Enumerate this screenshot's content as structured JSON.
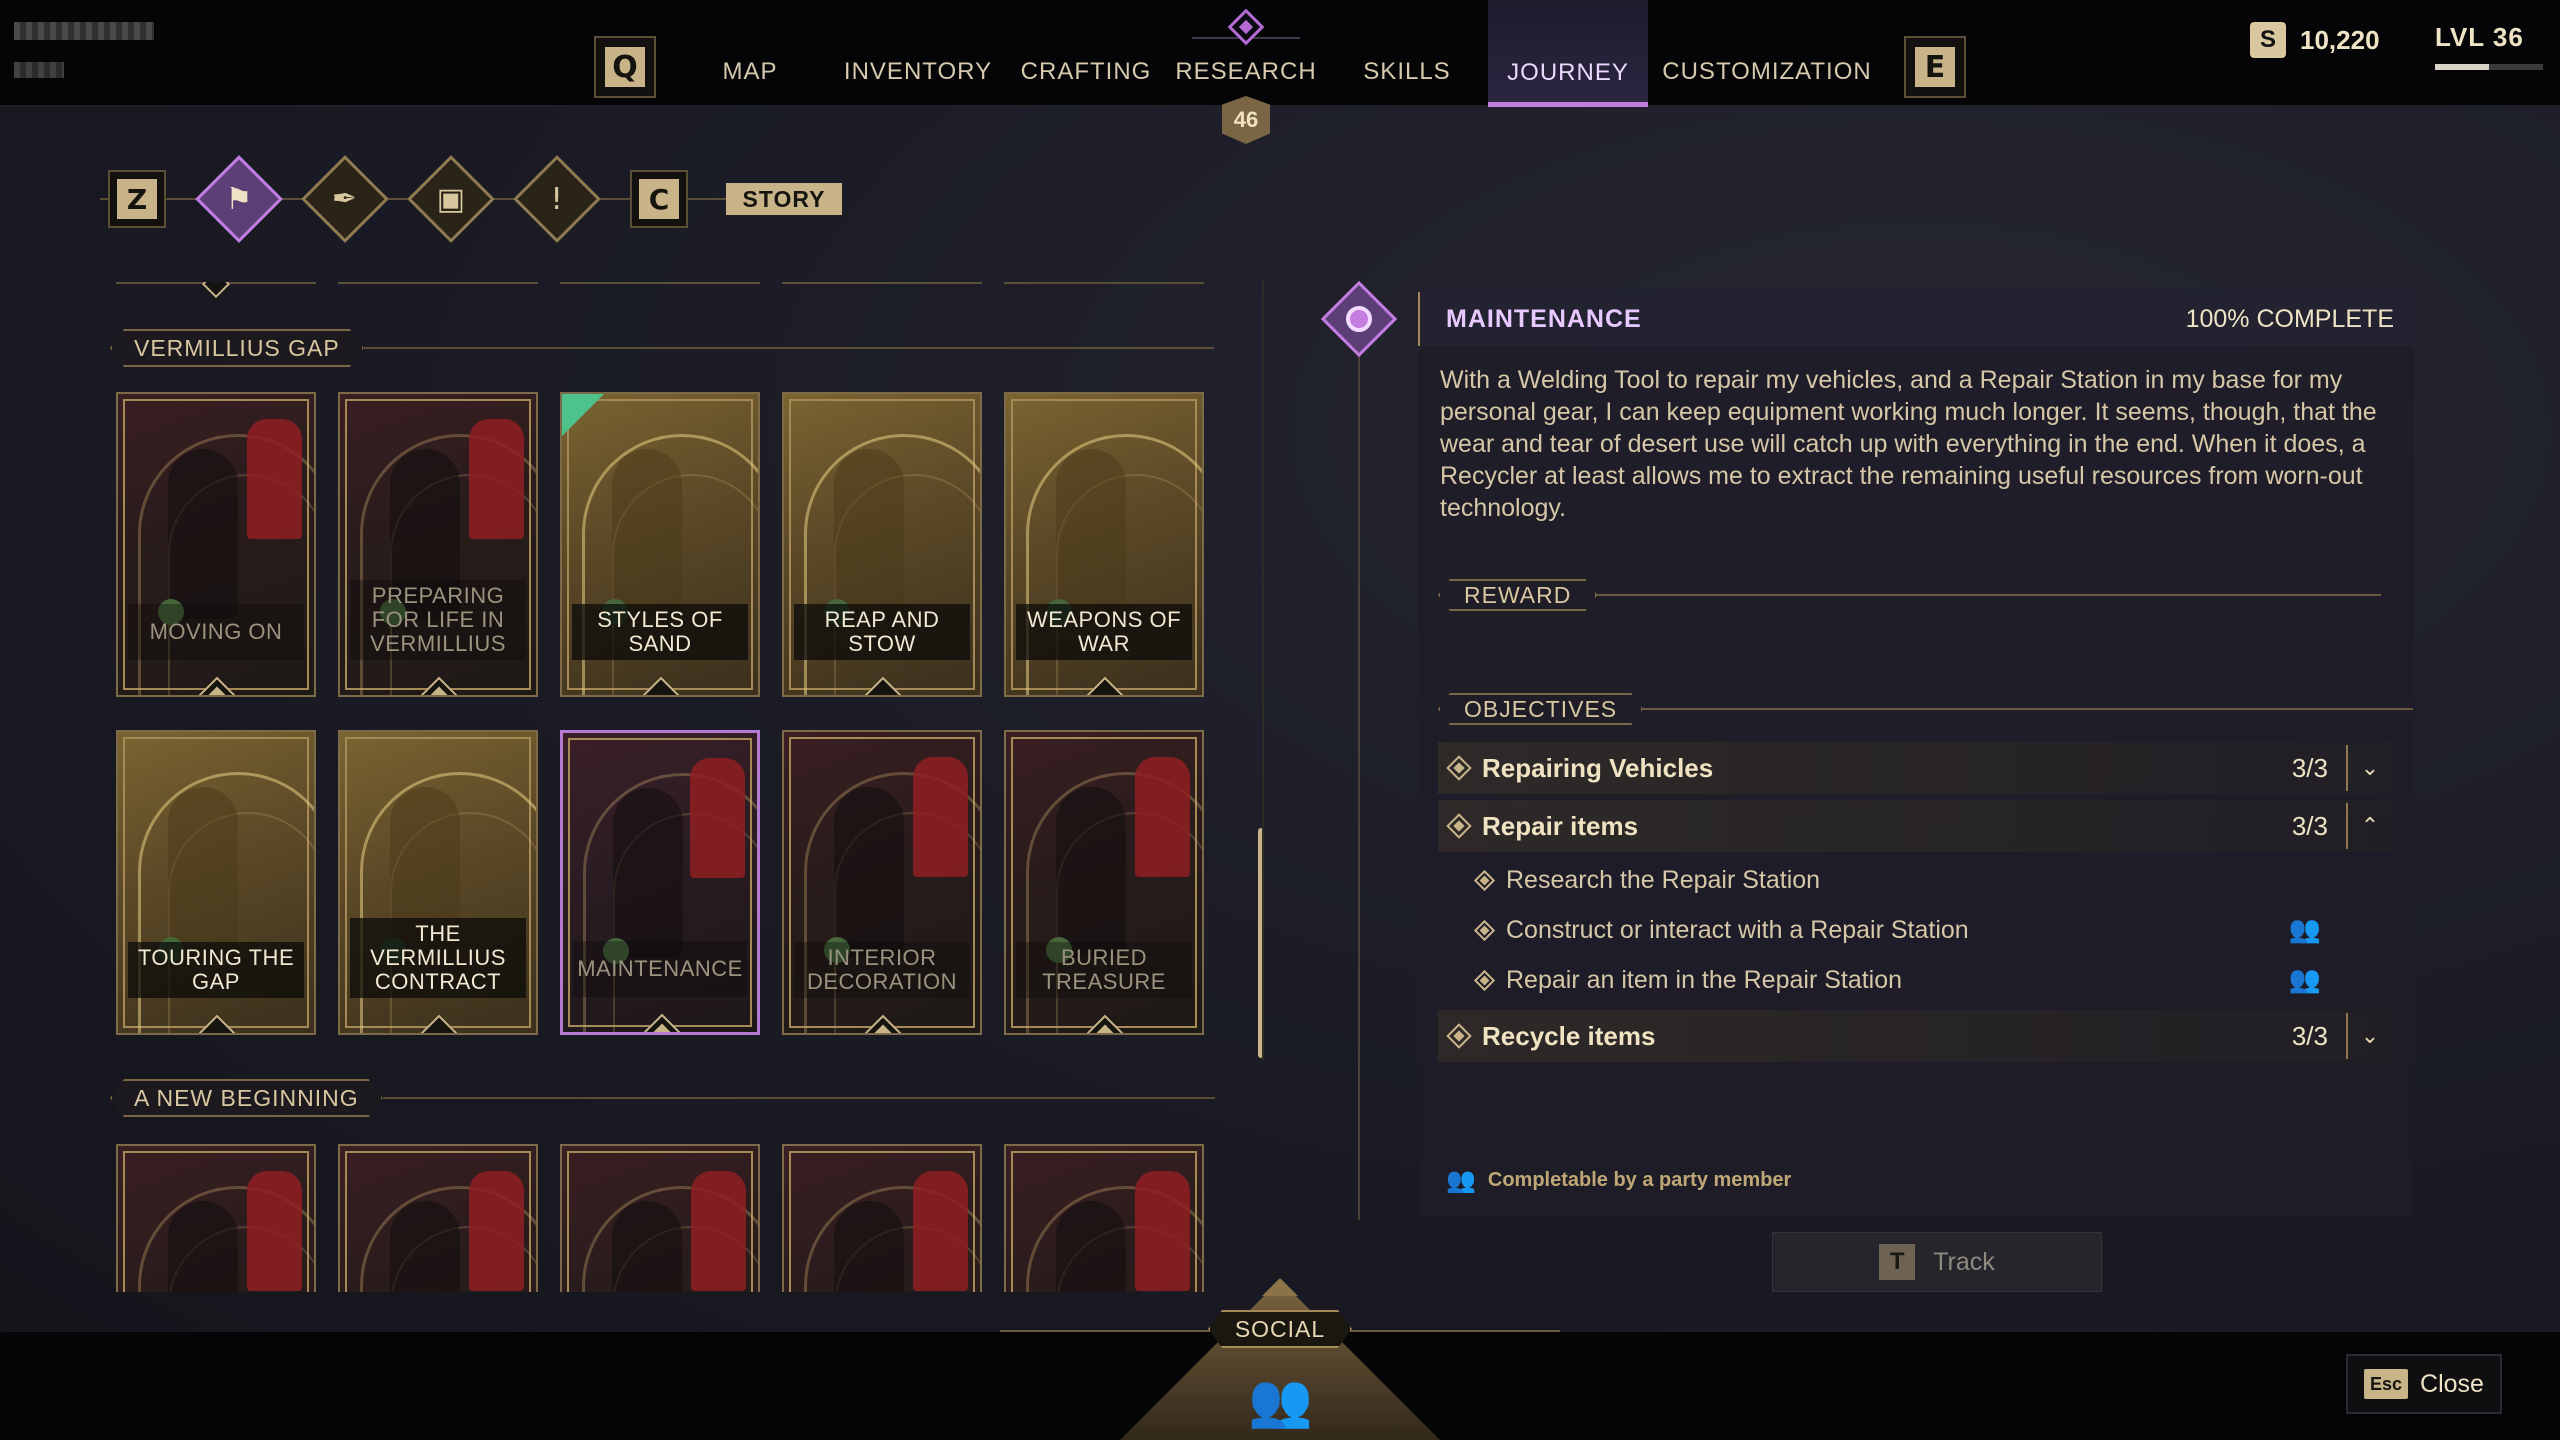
{
  "header": {
    "left_key": "Q",
    "right_key": "E",
    "tabs": [
      {
        "label": "MAP"
      },
      {
        "label": "INVENTORY"
      },
      {
        "label": "CRAFTING"
      },
      {
        "label": "RESEARCH",
        "badge": "46"
      },
      {
        "label": "SKILLS"
      },
      {
        "label": "JOURNEY",
        "active": true
      },
      {
        "label": "CUSTOMIZATION"
      }
    ],
    "currency_symbol": "S",
    "currency": "10,220",
    "level": "LVL 36",
    "level_progress": 0.5
  },
  "categories": {
    "prev_key": "Z",
    "next_key": "C",
    "icons": [
      "story-banner-icon",
      "quill-icon",
      "book-icon",
      "exclamation-note-icon"
    ],
    "active_label": "STORY"
  },
  "sections": [
    {
      "title": "VERMILLIUS GAP",
      "cards": [
        {
          "title": "MOVING ON",
          "state": "locked"
        },
        {
          "title": "PREPARING FOR LIFE IN VERMILLIUS",
          "state": "locked"
        },
        {
          "title": "STYLES OF SAND",
          "state": "completed",
          "ribbon": true
        },
        {
          "title": "REAP AND STOW",
          "state": "completed"
        },
        {
          "title": "WEAPONS OF WAR",
          "state": "completed"
        },
        {
          "title": "TOURING THE GAP",
          "state": "completed"
        },
        {
          "title": "THE VERMILLIUS CONTRACT",
          "state": "completed"
        },
        {
          "title": "MAINTENANCE",
          "state": "active"
        },
        {
          "title": "INTERIOR DECORATION",
          "state": "locked"
        },
        {
          "title": "BURIED TREASURE",
          "state": "locked"
        }
      ]
    },
    {
      "title": "A NEW BEGINNING",
      "cards": [
        {
          "title": "",
          "state": "locked"
        },
        {
          "title": "",
          "state": "locked"
        },
        {
          "title": "",
          "state": "locked"
        },
        {
          "title": "",
          "state": "locked"
        },
        {
          "title": "",
          "state": "locked"
        }
      ]
    }
  ],
  "detail": {
    "title": "MAINTENANCE",
    "completion": "100% COMPLETE",
    "description": "With a Welding Tool to repair my vehicles, and a Repair Station in my base for my personal gear, I can keep equipment working much longer. It seems, though, that the wear and tear of desert use will catch up with everything in the end. When it does, a Recycler at least allows me to extract the remaining useful resources from worn-out technology.",
    "reward_label": "REWARD",
    "objectives_label": "OBJECTIVES",
    "objectives": [
      {
        "title": "Repairing Vehicles",
        "count": "3/3",
        "expanded": false
      },
      {
        "title": "Repair items",
        "count": "3/3",
        "expanded": true,
        "subs": [
          {
            "title": "Research the Repair Station",
            "party": false
          },
          {
            "title": "Construct or interact with a Repair Station",
            "party": true
          },
          {
            "title": "Repair an item in the Repair Station",
            "party": true
          }
        ]
      },
      {
        "title": "Recycle items",
        "count": "3/3",
        "expanded": false
      }
    ],
    "footnote": "Completable by a party member",
    "track_key": "T",
    "track_label": "Track"
  },
  "bottom": {
    "social_label": "SOCIAL",
    "close_key": "Esc",
    "close_label": "Close"
  }
}
